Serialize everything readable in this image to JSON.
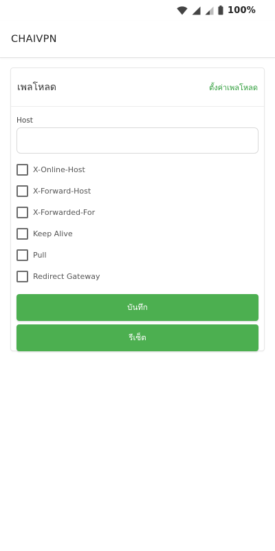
{
  "status_bar": {
    "battery_text": "100%",
    "icons": [
      "wifi-icon",
      "signal-icon",
      "signal-weak-icon",
      "battery-icon"
    ]
  },
  "app_bar": {
    "title": "CHAIVPN"
  },
  "payload_card": {
    "title": "เพลโหลด",
    "settings_link": "ตั้งค่าเพลโหลด",
    "host": {
      "label": "Host",
      "value": "",
      "placeholder": ""
    },
    "options": [
      {
        "label": "X-Online-Host",
        "checked": false
      },
      {
        "label": "X-Forward-Host",
        "checked": false
      },
      {
        "label": "X-Forwarded-For",
        "checked": false
      },
      {
        "label": "Keep Alive",
        "checked": false
      },
      {
        "label": "Pull",
        "checked": false
      },
      {
        "label": "Redirect Gateway",
        "checked": false
      }
    ],
    "save_button": "บันทึก",
    "reset_button": "รีเซ็ต"
  },
  "colors": {
    "accent": "#4caf50",
    "link": "#2e9d3a"
  }
}
